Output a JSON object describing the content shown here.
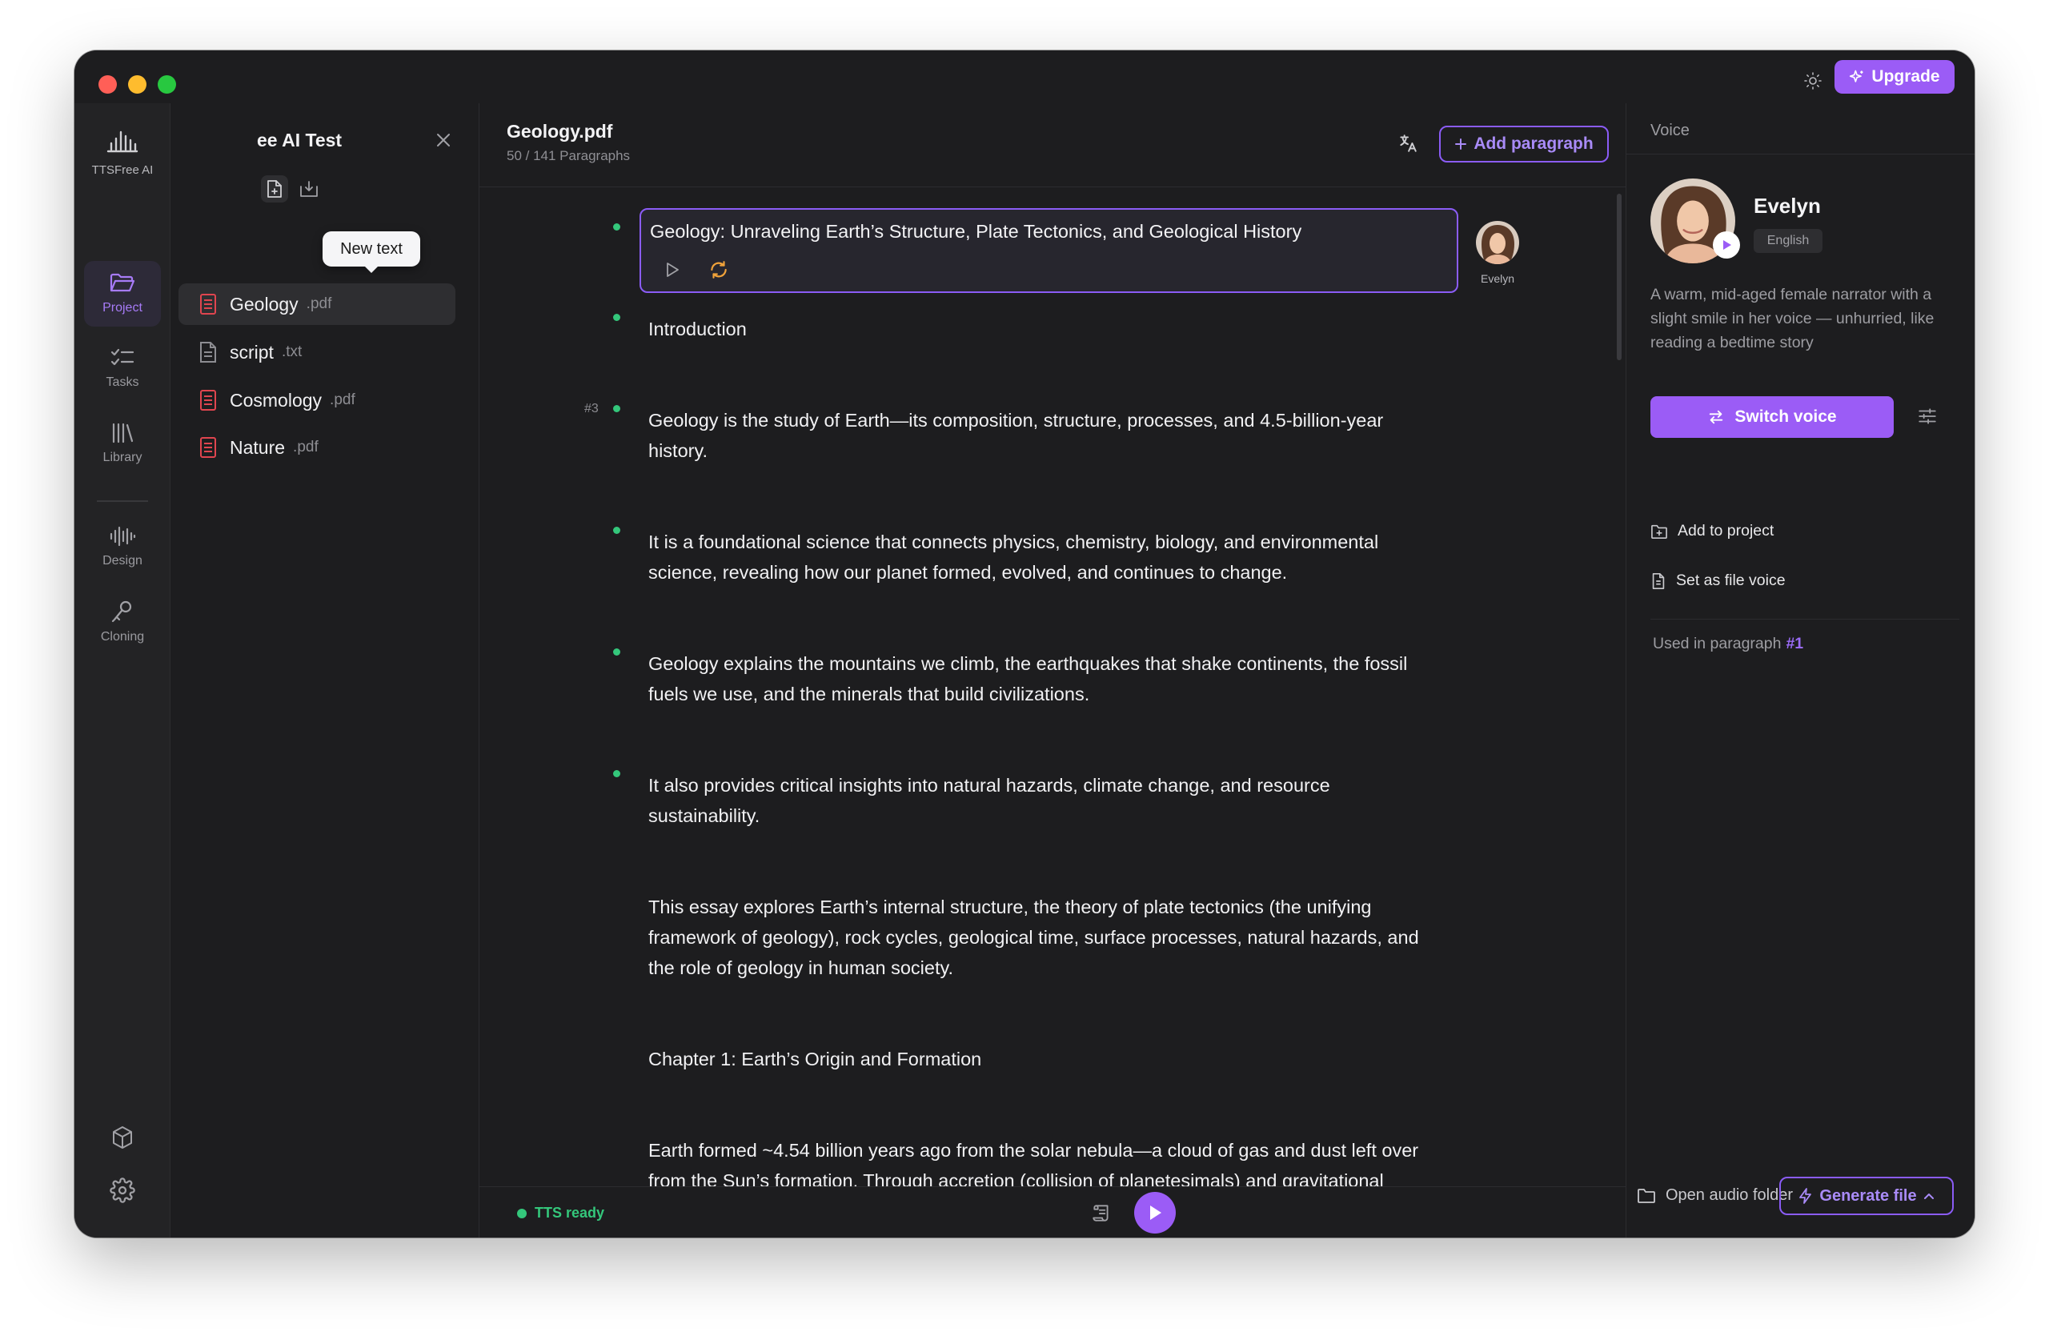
{
  "header": {
    "upgrade_label": "Upgrade"
  },
  "rail": {
    "app_name": "TTSFree AI",
    "items": [
      {
        "label": "Project",
        "icon": "folder-open-icon"
      },
      {
        "label": "Tasks",
        "icon": "checklist-icon"
      },
      {
        "label": "Library",
        "icon": "library-icon"
      },
      {
        "label": "Design",
        "icon": "waveform-icon"
      },
      {
        "label": "Cloning",
        "icon": "pen-icon"
      }
    ],
    "bottom_icons": [
      "package-icon",
      "gear-icon"
    ]
  },
  "files": {
    "project_title": "ee AI Test",
    "tooltip": "New text",
    "items": [
      {
        "name": "Geology",
        "ext": ".pdf",
        "type": "pdf"
      },
      {
        "name": "script",
        "ext": ".txt",
        "type": "txt"
      },
      {
        "name": "Cosmology",
        "ext": ".pdf",
        "type": "pdf"
      },
      {
        "name": "Nature",
        "ext": ".pdf",
        "type": "pdf"
      }
    ]
  },
  "editor": {
    "title": "Geology.pdf",
    "subtitle": "50 / 141 Paragraphs",
    "add_paragraph_label": "Add paragraph",
    "selected_paragraph": "Geology: Unraveling Earth’s Structure, Plate Tectonics, and Geological History",
    "selected_voice": "Evelyn",
    "paragraph_number": "#3",
    "paragraphs": [
      "Introduction",
      "Geology is the study of Earth—its composition, structure, processes, and 4.5-billion-year history.",
      "It is a foundational science that connects physics, chemistry, biology, and environmental science, revealing how our planet formed, evolved, and continues to change.",
      "Geology explains the mountains we climb, the earthquakes that shake continents, the fossil fuels we use, and the minerals that build civilizations.",
      "It also provides critical insights into natural hazards, climate change, and resource sustainability.",
      "This essay explores Earth’s internal structure, the theory of plate tectonics (the unifying framework of geology), rock cycles, geological time, surface processes, natural hazards, and the role of geology in human society.",
      "Chapter 1: Earth’s Origin and Formation",
      "Earth formed ~4.54 billion years ago from the solar nebula—a cloud of gas and dust left over from the Sun’s formation. Through accretion (collision of planetesimals) and gravitational"
    ]
  },
  "bottombar": {
    "status": "TTS ready",
    "open_folder_label": "Open audio folder",
    "generate_label": "Generate file"
  },
  "voice": {
    "heading": "Voice",
    "name": "Evelyn",
    "language": "English",
    "description": "A warm, mid-aged female narrator with a slight smile in her voice — unhurried, like reading a bedtime story",
    "switch_label": "Switch voice",
    "add_to_project": "Add to project",
    "set_as_file_voice": "Set as file voice",
    "used_in_label": "Used in paragraph",
    "used_in_number": "#1"
  },
  "colors": {
    "accent": "#9b5cf6",
    "ready": "#34c77b",
    "pdf": "#e0454f"
  }
}
